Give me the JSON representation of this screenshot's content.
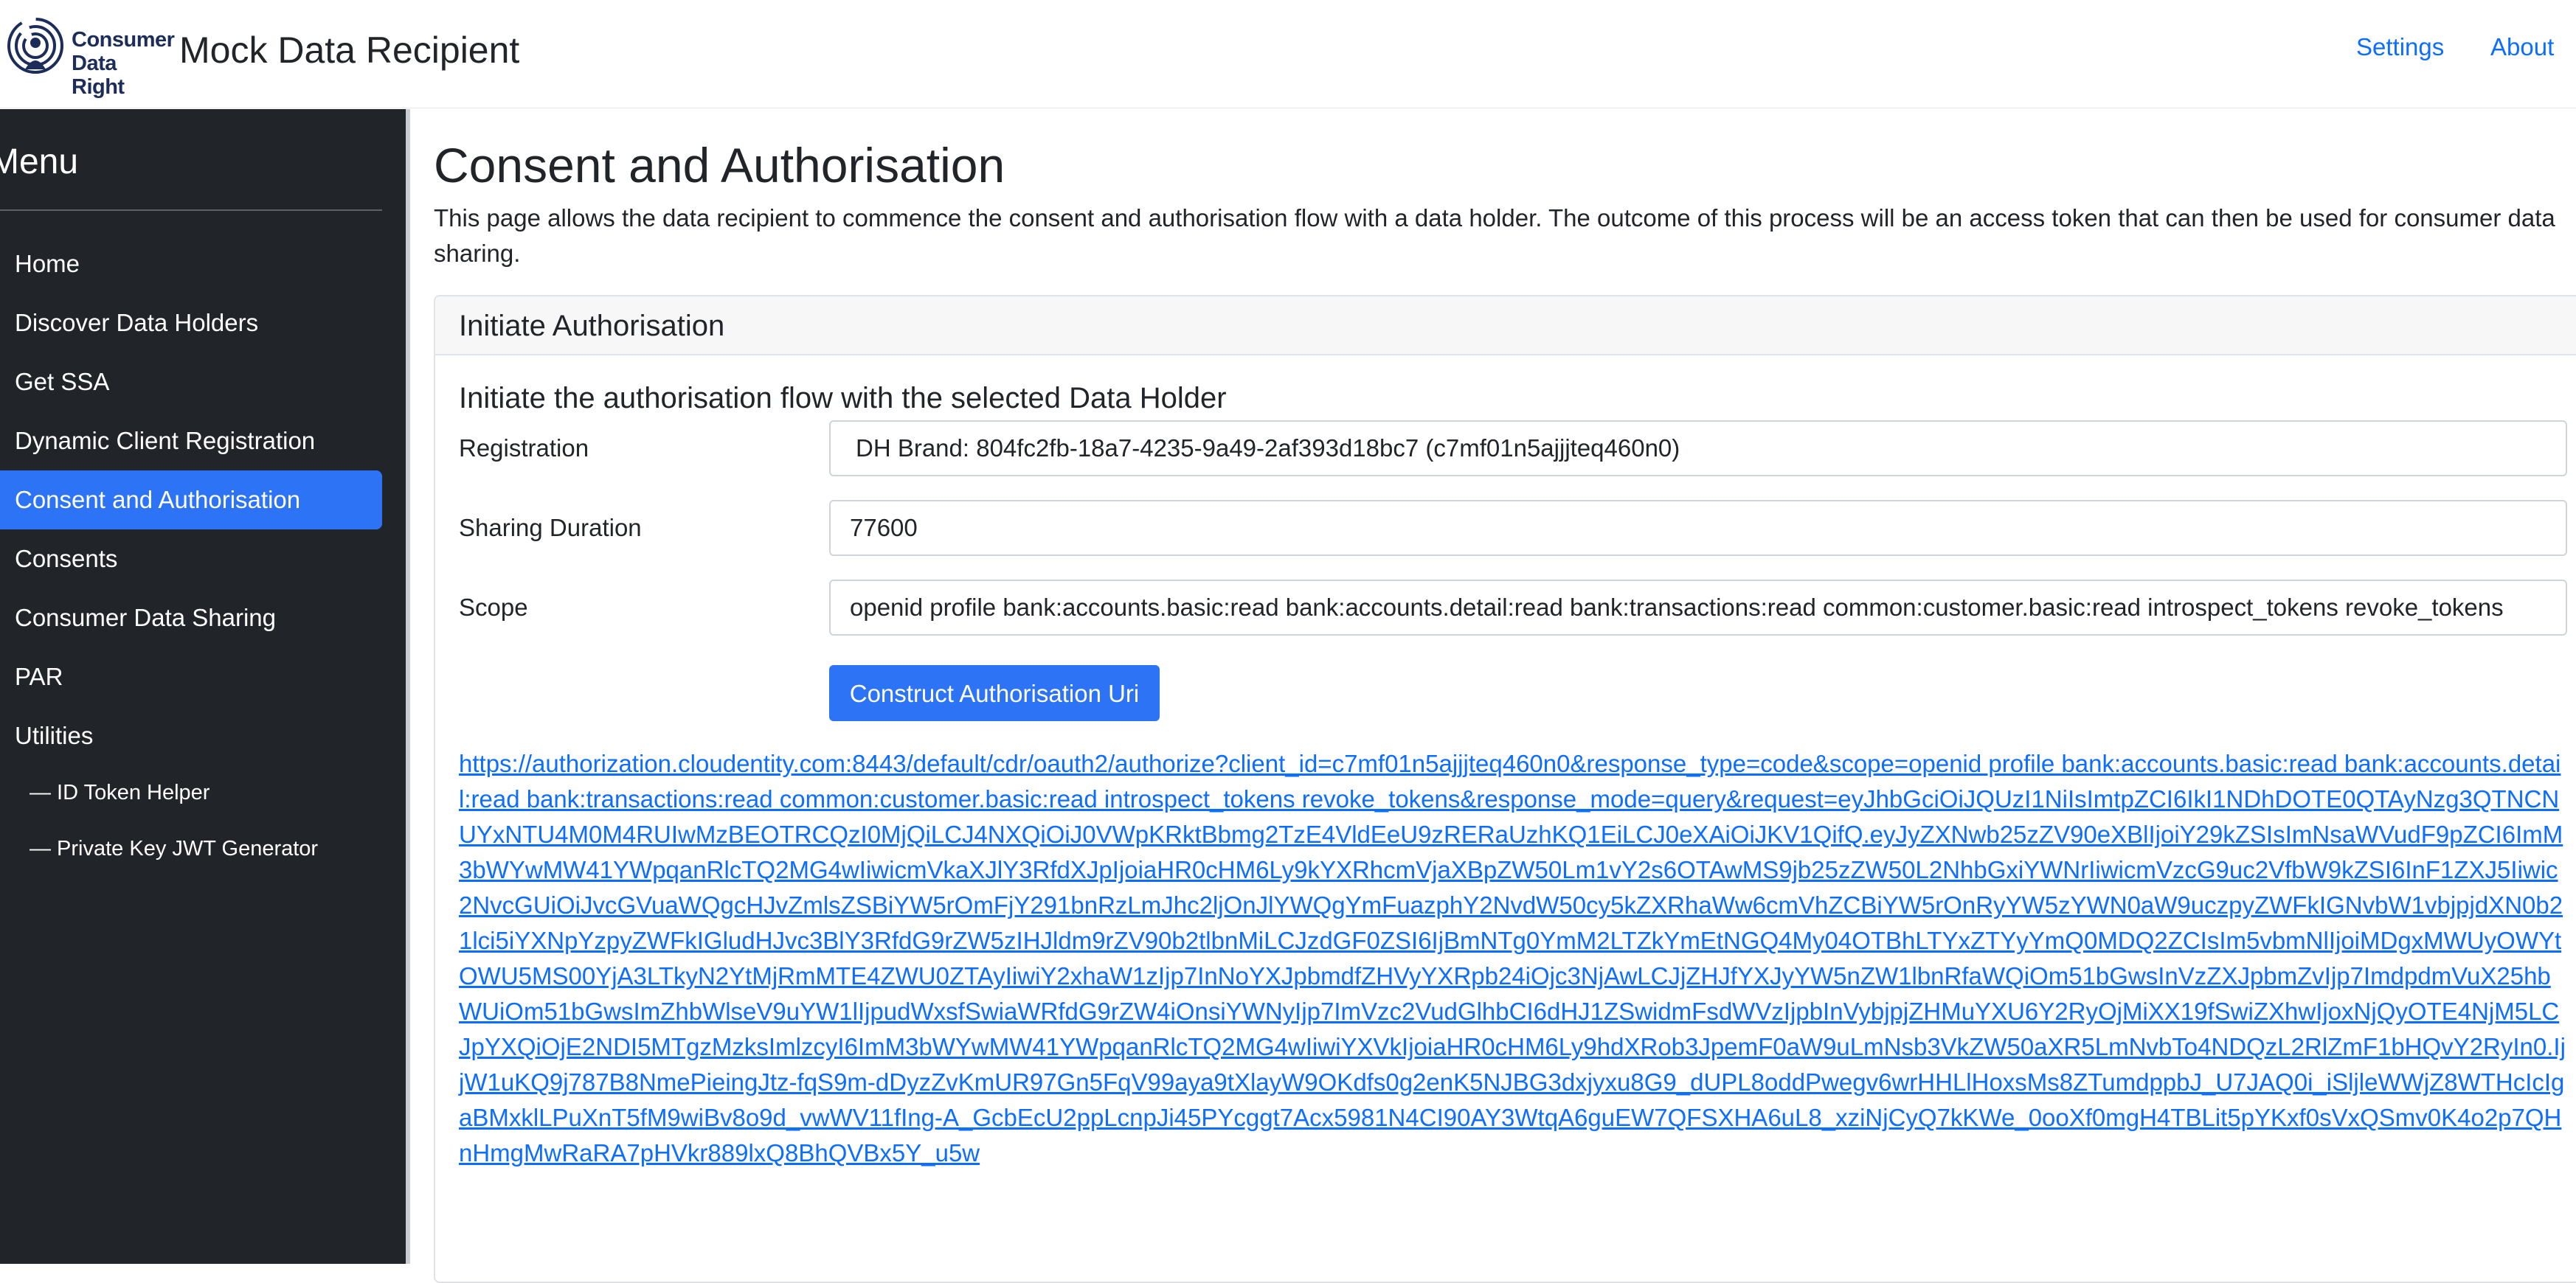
{
  "header": {
    "logo_icon": "consumer-data-right-logo",
    "logo_text_line1": "Consumer",
    "logo_text_line2": "Data Right",
    "app_title": "Mock Data Recipient",
    "nav": {
      "settings": "Settings",
      "about": "About"
    }
  },
  "sidebar": {
    "title": "Menu",
    "items": [
      {
        "label": "Home"
      },
      {
        "label": "Discover Data Holders"
      },
      {
        "label": "Get SSA"
      },
      {
        "label": "Dynamic Client Registration"
      },
      {
        "label": "Consent and Authorisation",
        "active": true
      },
      {
        "label": "Consents"
      },
      {
        "label": "Consumer Data Sharing"
      },
      {
        "label": "PAR"
      },
      {
        "label": "Utilities"
      }
    ],
    "sub_items": [
      {
        "label": "— ID Token Helper"
      },
      {
        "label": "— Private Key JWT Generator"
      }
    ],
    "active_color": "#2d73f5"
  },
  "main": {
    "title": "Consent and Authorisation",
    "description": "This page allows the data recipient to commence the consent and authorisation flow with a data holder. The outcome of this process will be an access token that can then be used for consumer data sharing.",
    "card": {
      "header": "Initiate Authorisation",
      "subtitle": "Initiate the authorisation flow with the selected Data Holder",
      "fields": {
        "registration": {
          "label": "Registration",
          "value": "DH Brand: 804fc2fb-18a7-4235-9a49-2af393d18bc7 (c7mf01n5ajjjteq460n0)"
        },
        "sharing_duration": {
          "label": "Sharing Duration",
          "value": "77600"
        },
        "scope": {
          "label": "Scope",
          "value": "openid profile bank:accounts.basic:read bank:accounts.detail:read bank:transactions:read common:customer.basic:read introspect_tokens revoke_tokens"
        }
      },
      "construct_button": "Construct Authorisation Uri",
      "auth_url": "https://authorization.cloudentity.com:8443/default/cdr/oauth2/authorize?client_id=c7mf01n5ajjjteq460n0&response_type=code&scope=openid profile bank:accounts.basic:read bank:accounts.detail:read bank:transactions:read common:customer.basic:read introspect_tokens revoke_tokens&response_mode=query&request=eyJhbGciOiJQUzI1NiIsImtpZCI6IkI1NDhDOTE0QTAyNzg3QTNCNUYxNTU4M0M4RUIwMzBEOTRCQzI0MjQiLCJ4NXQiOiJ0VWpKRktBbmg2TzE4VldEeU9zRERaUzhKQ1EiLCJ0eXAiOiJKV1QifQ.eyJyZXNwb25zZV90eXBlIjoiY29kZSIsImNsaWVudF9pZCI6ImM3bWYwMW41YWpqanRlcTQ2MG4wIiwicmVkaXJlY3RfdXJpIjoiaHR0cHM6Ly9kYXRhcmVjaXBpZW50Lm1vY2s6OTAwMS9jb25zZW50L2NhbGxiYWNrIiwicmVzcG9uc2VfbW9kZSI6InF1ZXJ5Iiwic2NvcGUiOiJvcGVuaWQgcHJvZmlsZSBiYW5rOmFjY291bnRzLmJhc2ljOnJlYWQgYmFuazphY2NvdW50cy5kZXRhaWw6cmVhZCBiYW5rOnRyYW5zYWN0aW9uczpyZWFkIGNvbW1vbjpjdXN0b21lci5iYXNpYzpyZWFkIGludHJvc3BlY3RfdG9rZW5zIHJldm9rZV90b2tlbnMiLCJzdGF0ZSI6IjBmNTg0YmM2LTZkYmEtNGQ4My04OTBhLTYxZTYyYmQ0MDQ2ZCIsIm5vbmNlIjoiMDgxMWUyOWYtOWU5MS00YjA3LTkyN2YtMjRmMTE4ZWU0ZTAyIiwiY2xhaW1zIjp7InNoYXJpbmdfZHVyYXRpb24iOjc3NjAwLCJjZHJfYXJyYW5nZW1lbnRfaWQiOm51bGwsInVzZXJpbmZvIjp7ImdpdmVuX25hbWUiOm51bGwsImZhbWlseV9uYW1lIjpudWxsfSwiaWRfdG9rZW4iOnsiYWNyIjp7ImVzc2VudGlhbCI6dHJ1ZSwidmFsdWVzIjpbInVybjpjZHMuYXU6Y2RyOjMiXX19fSwiZXhwIjoxNjQyOTE4NjM5LCJpYXQiOjE2NDI5MTgzMzksImlzcyI6ImM3bWYwMW41YWpqanRlcTQ2MG4wIiwiYXVkIjoiaHR0cHM6Ly9hdXRob3JpemF0aW9uLmNsb3VkZW50aXR5LmNvbTo4NDQzL2RlZmF1bHQvY2RyIn0.IjjW1uKQ9j787B8NmePieingJtz-fqS9m-dDyzZvKmUR97Gn5FqV99aya9tXlayW9OKdfs0g2enK5NJBG3dxjyxu8G9_dUPL8oddPwegv6wrHHLlHoxsMs8ZTumdppbJ_U7JAQ0i_iSljleWWjZ8WTHcIcIgaBMxklLPuXnT5fM9wiBv8o9d_vwWV11fIng-A_GcbEcU2ppLcnpJi45PYcggt7Acx5981N4CI90AY3WtqA6guEW7QFSXHA6uL8_xziNjCyQ7kKWe_0ooXf0mgH4TBLit5pYKxf0sVxQSmv0K4o2p7QHnHmgMwRaRA7pHVkr889lxQ8BhQVBx5Y_u5w"
    }
  }
}
